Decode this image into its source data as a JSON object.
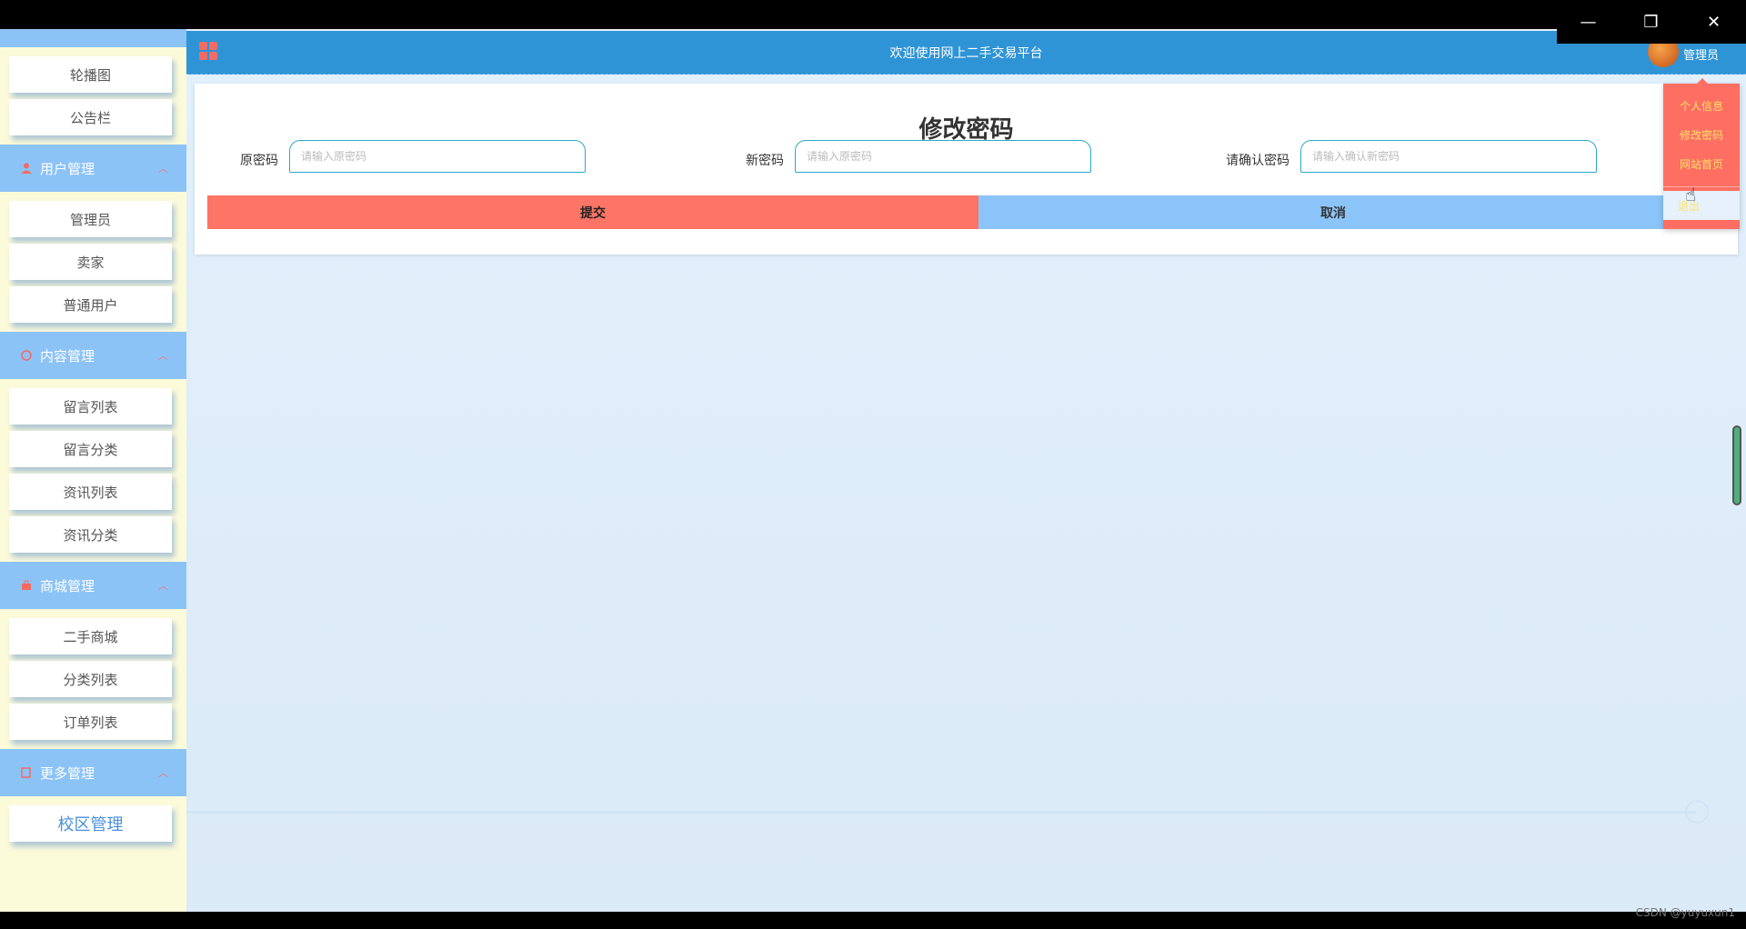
{
  "window": {
    "minimize": "—",
    "restore": "❐",
    "close": "✕",
    "watermark": "CSDN @yuyuxun1"
  },
  "header": {
    "title": "欢迎使用网上二手交易平台",
    "user": "管理员"
  },
  "sidebar": {
    "top_items": [
      "轮播图",
      "公告栏"
    ],
    "groups": [
      {
        "label": "用户管理",
        "icon": "user-icon",
        "items": [
          "管理员",
          "卖家",
          "普通用户"
        ]
      },
      {
        "label": "内容管理",
        "icon": "content-icon",
        "items": [
          "留言列表",
          "留言分类",
          "资讯列表",
          "资讯分类"
        ]
      },
      {
        "label": "商城管理",
        "icon": "shop-icon",
        "items": [
          "二手商城",
          "分类列表",
          "订单列表"
        ]
      },
      {
        "label": "更多管理",
        "icon": "more-icon",
        "items": [
          "校区管理"
        ]
      }
    ]
  },
  "form": {
    "title": "修改密码",
    "fields": [
      {
        "label": "原密码",
        "placeholder": "请输入原密码"
      },
      {
        "label": "新密码",
        "placeholder": "请输入原密码"
      },
      {
        "label": "请确认密码",
        "placeholder": "请输入确认新密码"
      }
    ],
    "submit": "提交",
    "cancel": "取消"
  },
  "dropdown": {
    "items": [
      "个人信息",
      "修改密码",
      "网站首页"
    ],
    "logout": "退出"
  },
  "colors": {
    "header": "#2f94d6",
    "sidebar_group": "#8cc3f7",
    "submit": "#fe7466",
    "cancel": "#8bc4f8",
    "dropdown": "#fe6e62"
  }
}
